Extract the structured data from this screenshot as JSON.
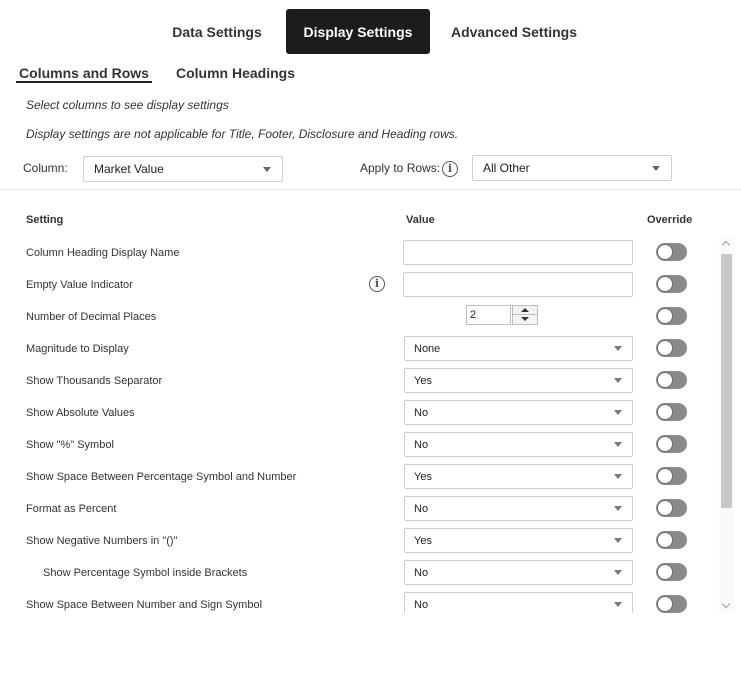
{
  "top_tabs": {
    "data_settings": "Data Settings",
    "display_settings": "Display Settings",
    "advanced_settings": "Advanced Settings",
    "active": "Display Settings"
  },
  "sub_tabs": {
    "columns_and_rows": "Columns and Rows",
    "column_headings": "Column Headings",
    "active": "Columns and Rows"
  },
  "notes": {
    "select_hint": "Select columns to see display settings",
    "not_applicable": "Display settings are not applicable for Title, Footer, Disclosure and Heading rows."
  },
  "column_filter": {
    "label": "Column:",
    "value": "Market Value"
  },
  "apply_rows": {
    "label": "Apply to Rows:",
    "value": "All Other"
  },
  "table": {
    "headers": {
      "setting": "Setting",
      "value": "Value",
      "override": "Override"
    },
    "rows": [
      {
        "name": "Column Heading Display Name",
        "control": "textbox",
        "value": "",
        "override": false
      },
      {
        "name": "Empty Value Indicator",
        "control": "textbox",
        "value": "",
        "info": true,
        "override": false
      },
      {
        "name": "Number of Decimal Places",
        "control": "stepper",
        "value": "2",
        "override": false
      },
      {
        "name": "Magnitude to Display",
        "control": "dropdown",
        "value": "None",
        "override": false
      },
      {
        "name": "Show Thousands Separator",
        "control": "dropdown",
        "value": "Yes",
        "override": false
      },
      {
        "name": "Show Absolute Values",
        "control": "dropdown",
        "value": "No",
        "override": false
      },
      {
        "name": "Show \"%\" Symbol",
        "control": "dropdown",
        "value": "No",
        "override": false
      },
      {
        "name": "Show Space Between Percentage Symbol and Number",
        "control": "dropdown",
        "value": "Yes",
        "override": false
      },
      {
        "name": "Format as Percent",
        "control": "dropdown",
        "value": "No",
        "override": false
      },
      {
        "name": "Show Negative Numbers in \"()\"",
        "control": "dropdown",
        "value": "Yes",
        "override": false
      },
      {
        "name": "Show Percentage Symbol inside Brackets",
        "control": "dropdown",
        "value": "No",
        "indent": true,
        "override": false
      },
      {
        "name": "Show Space Between Number and Sign Symbol",
        "control": "dropdown",
        "value": "No",
        "override": false
      }
    ]
  },
  "colors": {
    "active_tab_bg": "#1c1c1c",
    "toggle_off": "#8a8a8a",
    "border": "#cfcfcf"
  },
  "icons": {
    "info": "info-icon",
    "caret": "chevron-down-icon"
  }
}
